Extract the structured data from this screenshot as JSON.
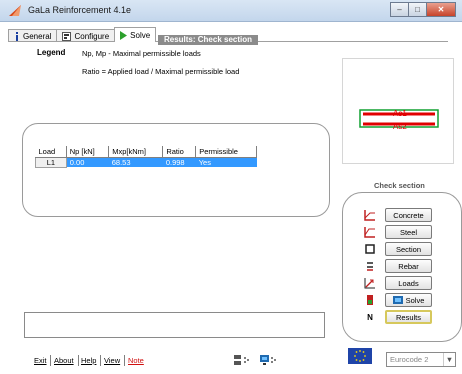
{
  "window": {
    "title": "GaLa Reinforcement  4.1e",
    "minimize_label": "–",
    "maximize_label": "□",
    "close_label": "✕"
  },
  "tabs": [
    {
      "label": "General",
      "icon": "info-icon"
    },
    {
      "label": "Configure",
      "icon": "configure-icon"
    },
    {
      "label": "Solve",
      "icon": "play-icon",
      "active": true
    }
  ],
  "results": {
    "header": "Results: Check section",
    "legend_title": "Legend",
    "legend_line1": "Np, Mp  - Maximal permissible loads",
    "legend_line2": "Ratio  =  Applied load / Maximal permissible load"
  },
  "preview": {
    "top_label": "As1",
    "bottom_label": "As2",
    "bar_color": "#e00000",
    "outline_color": "#10a030"
  },
  "load_table": {
    "columns": [
      "Load",
      "Np [kN]",
      "Mxp[kNm]",
      "Ratio",
      "Permissible"
    ],
    "rows": [
      {
        "load": "L1",
        "np": "0.00",
        "mxp": "68.53",
        "ratio": "0.998",
        "permissible": "Yes"
      }
    ],
    "selection_color": "#3399ff"
  },
  "check_section": {
    "title": "Check section",
    "buttons": [
      {
        "label": "Concrete",
        "icon": "concrete-icon"
      },
      {
        "label": "Steel",
        "icon": "steel-icon"
      },
      {
        "label": "Section",
        "icon": "section-icon"
      },
      {
        "label": "Rebar",
        "icon": "rebar-icon"
      },
      {
        "label": "Loads",
        "icon": "loads-icon"
      },
      {
        "label": "Solve",
        "icon": "solve-icon"
      },
      {
        "label": "Results",
        "icon": "n-icon",
        "icon_text": "N"
      }
    ]
  },
  "bottom_menu": {
    "exit": "Exit",
    "about": "About",
    "help": "Help",
    "view": "View",
    "note": "Note"
  },
  "code_select": {
    "value": "Eurocode 2",
    "arrow": "▼"
  }
}
